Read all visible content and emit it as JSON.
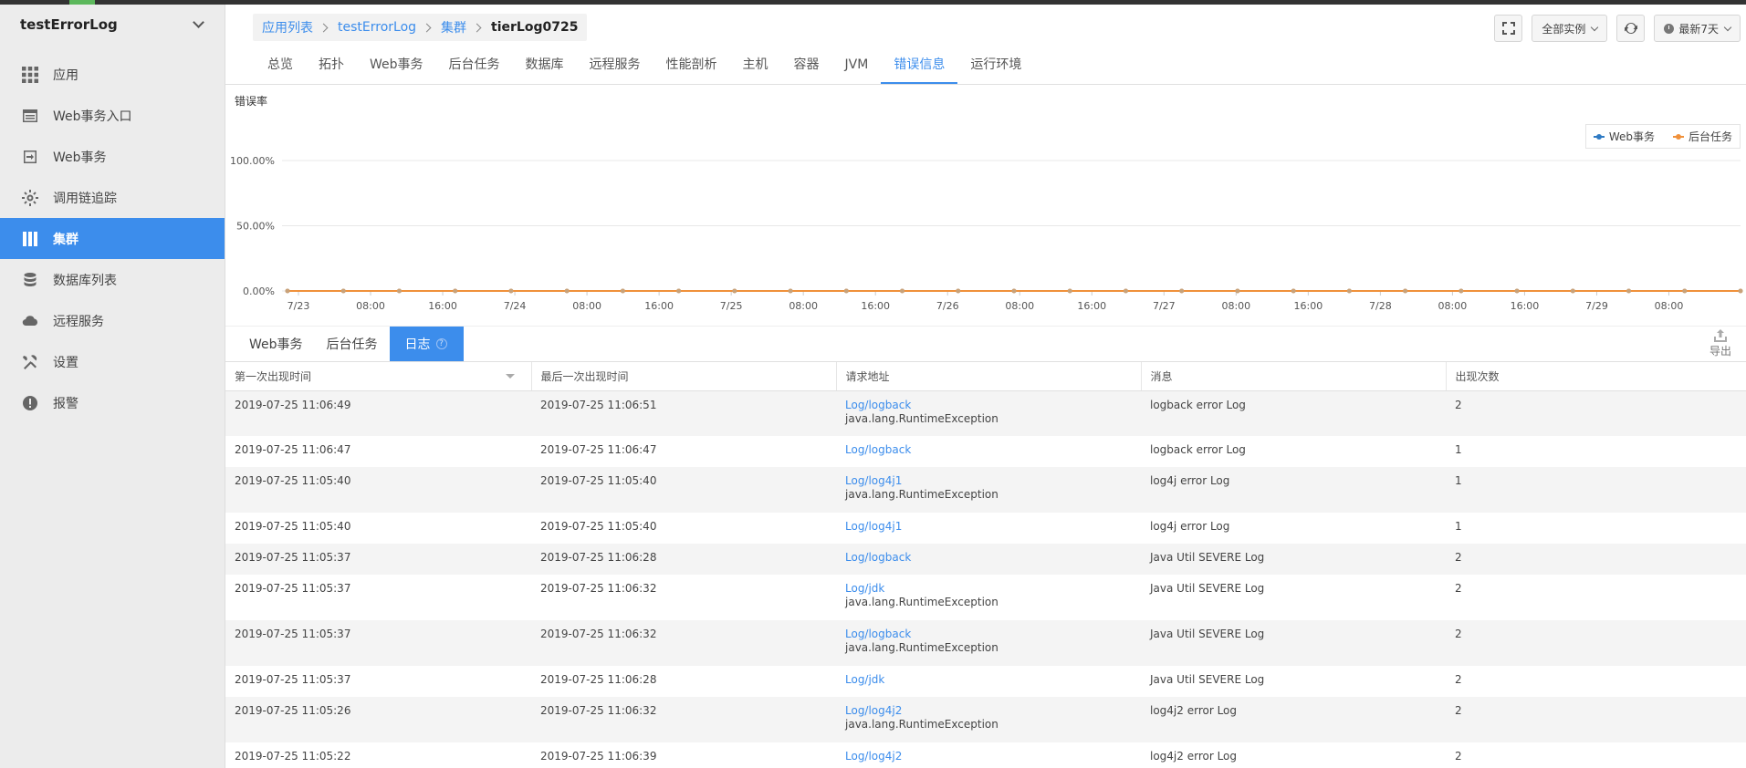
{
  "app": {
    "name": "testErrorLog"
  },
  "colors": {
    "accent": "#3c8dec",
    "web": "#2f7bc4",
    "bg_task": "#f0913b",
    "point": "#c8a27a"
  },
  "sidebar": {
    "items": [
      {
        "label": "应用",
        "icon": "grid-icon"
      },
      {
        "label": "Web事务入口",
        "icon": "list-window-icon"
      },
      {
        "label": "Web事务",
        "icon": "enter-icon"
      },
      {
        "label": "调用链追踪",
        "icon": "gear-icon"
      },
      {
        "label": "集群",
        "icon": "columns-icon"
      },
      {
        "label": "数据库列表",
        "icon": "database-icon"
      },
      {
        "label": "远程服务",
        "icon": "cloud-icon"
      },
      {
        "label": "设置",
        "icon": "wrench-icon"
      },
      {
        "label": "报警",
        "icon": "alert-icon"
      }
    ]
  },
  "breadcrumb": {
    "apps": "应用列表",
    "app": "testErrorLog",
    "cluster": "集群",
    "current": "tierLog0725"
  },
  "toolbar": {
    "instances": "全部实例",
    "range": "最新7天"
  },
  "tabs": [
    "总览",
    "拓扑",
    "Web事务",
    "后台任务",
    "数据库",
    "远程服务",
    "性能剖析",
    "主机",
    "容器",
    "JVM",
    "错误信息",
    "运行环境"
  ],
  "chart_data": {
    "type": "line",
    "title": "错误率",
    "xlabel": "",
    "ylabel": "",
    "ylim": [
      0,
      100
    ],
    "y_ticks": [
      "0.00%",
      "50.00%",
      "100.00%"
    ],
    "x_tick_labels": [
      "7/23",
      "08:00",
      "16:00",
      "7/24",
      "08:00",
      "16:00",
      "7/25",
      "08:00",
      "16:00",
      "7/26",
      "08:00",
      "16:00",
      "7/27",
      "08:00",
      "16:00",
      "7/28",
      "08:00",
      "16:00",
      "7/29",
      "08:00"
    ],
    "legend": "top-right",
    "grid": true,
    "series": [
      {
        "name": "Web事务",
        "values": [
          0,
          0,
          0,
          0,
          0,
          0,
          0,
          0,
          0,
          0,
          0,
          0,
          0,
          0,
          0,
          0,
          0,
          0,
          0,
          0,
          0,
          0,
          0,
          0,
          0,
          0,
          0
        ]
      },
      {
        "name": "后台任务",
        "values": [
          0,
          0,
          0,
          0,
          0,
          0,
          0,
          0,
          0,
          0,
          0,
          0,
          0,
          0,
          0,
          0,
          0,
          0,
          0,
          0,
          0,
          0,
          0,
          0,
          0,
          0,
          0
        ]
      }
    ]
  },
  "subtabs": [
    "Web事务",
    "后台任务",
    "日志"
  ],
  "export_label": "导出",
  "table": {
    "headers": [
      "第一次出现时间",
      "最后一次出现时间",
      "请求地址",
      "消息",
      "出现次数"
    ],
    "rows": [
      {
        "first": "2019-07-25 11:06:49",
        "last": "2019-07-25 11:06:51",
        "url": "Log/logback",
        "exception": "java.lang.RuntimeException",
        "message": "logback error Log",
        "count": "2"
      },
      {
        "first": "2019-07-25 11:06:47",
        "last": "2019-07-25 11:06:47",
        "url": "Log/logback",
        "exception": "",
        "message": "logback error Log",
        "count": "1"
      },
      {
        "first": "2019-07-25 11:05:40",
        "last": "2019-07-25 11:05:40",
        "url": "Log/log4j1",
        "exception": "java.lang.RuntimeException",
        "message": "log4j error Log",
        "count": "1"
      },
      {
        "first": "2019-07-25 11:05:40",
        "last": "2019-07-25 11:05:40",
        "url": "Log/log4j1",
        "exception": "",
        "message": "log4j error Log",
        "count": "1"
      },
      {
        "first": "2019-07-25 11:05:37",
        "last": "2019-07-25 11:06:28",
        "url": "Log/logback",
        "exception": "",
        "message": "Java Util SEVERE Log",
        "count": "2"
      },
      {
        "first": "2019-07-25 11:05:37",
        "last": "2019-07-25 11:06:32",
        "url": "Log/jdk",
        "exception": "java.lang.RuntimeException",
        "message": "Java Util SEVERE Log",
        "count": "2"
      },
      {
        "first": "2019-07-25 11:05:37",
        "last": "2019-07-25 11:06:32",
        "url": "Log/logback",
        "exception": "java.lang.RuntimeException",
        "message": "Java Util SEVERE Log",
        "count": "2"
      },
      {
        "first": "2019-07-25 11:05:37",
        "last": "2019-07-25 11:06:28",
        "url": "Log/jdk",
        "exception": "",
        "message": "Java Util SEVERE Log",
        "count": "2"
      },
      {
        "first": "2019-07-25 11:05:26",
        "last": "2019-07-25 11:06:32",
        "url": "Log/log4j2",
        "exception": "java.lang.RuntimeException",
        "message": "log4j2 error Log",
        "count": "2"
      },
      {
        "first": "2019-07-25 11:05:22",
        "last": "2019-07-25 11:06:39",
        "url": "Log/log4j2",
        "exception": "",
        "message": "log4j2 error Log",
        "count": "2"
      }
    ]
  }
}
